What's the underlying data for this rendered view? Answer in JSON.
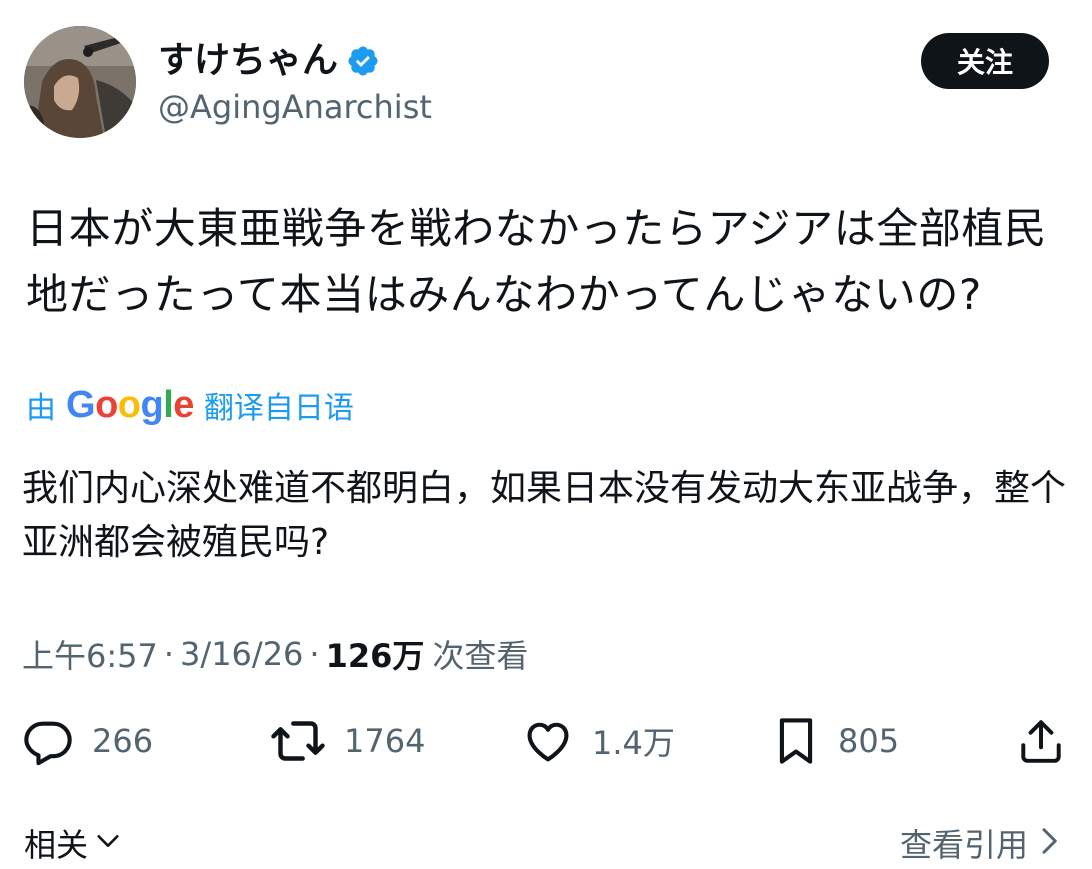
{
  "author": {
    "display_name": "すけちゃん",
    "handle": "@AgingAnarchist",
    "verified": true,
    "verified_color": "#1d9bf0"
  },
  "follow_button": {
    "label": "关注"
  },
  "post": {
    "text": "日本が大東亜戦争を戦わなかったらアジアは全部植民地だったって本当はみんなわかってんじゃないの?"
  },
  "translation": {
    "prefix": "由",
    "provider": "Google",
    "suffix": "翻译自日语",
    "text": "我们内心深处难道不都明白，如果日本没有发动大东亚战争，整个亚洲都会被殖民吗?"
  },
  "meta": {
    "time": "上午6:57",
    "date": "3/16/26",
    "views_count": "126万",
    "views_label": "次查看",
    "separator": "·"
  },
  "actions": {
    "reply": {
      "icon": "reply-icon",
      "count": "266"
    },
    "repost": {
      "icon": "repost-icon",
      "count": "1764"
    },
    "like": {
      "icon": "heart-icon",
      "count": "1.4万"
    },
    "bookmark": {
      "icon": "bookmark-icon",
      "count": "805"
    },
    "share": {
      "icon": "share-icon"
    }
  },
  "footer": {
    "related_label": "相关",
    "view_quotes_label": "查看引用"
  },
  "colors": {
    "text_primary": "#0f1419",
    "text_secondary": "#536471",
    "accent": "#1d9bf0"
  }
}
